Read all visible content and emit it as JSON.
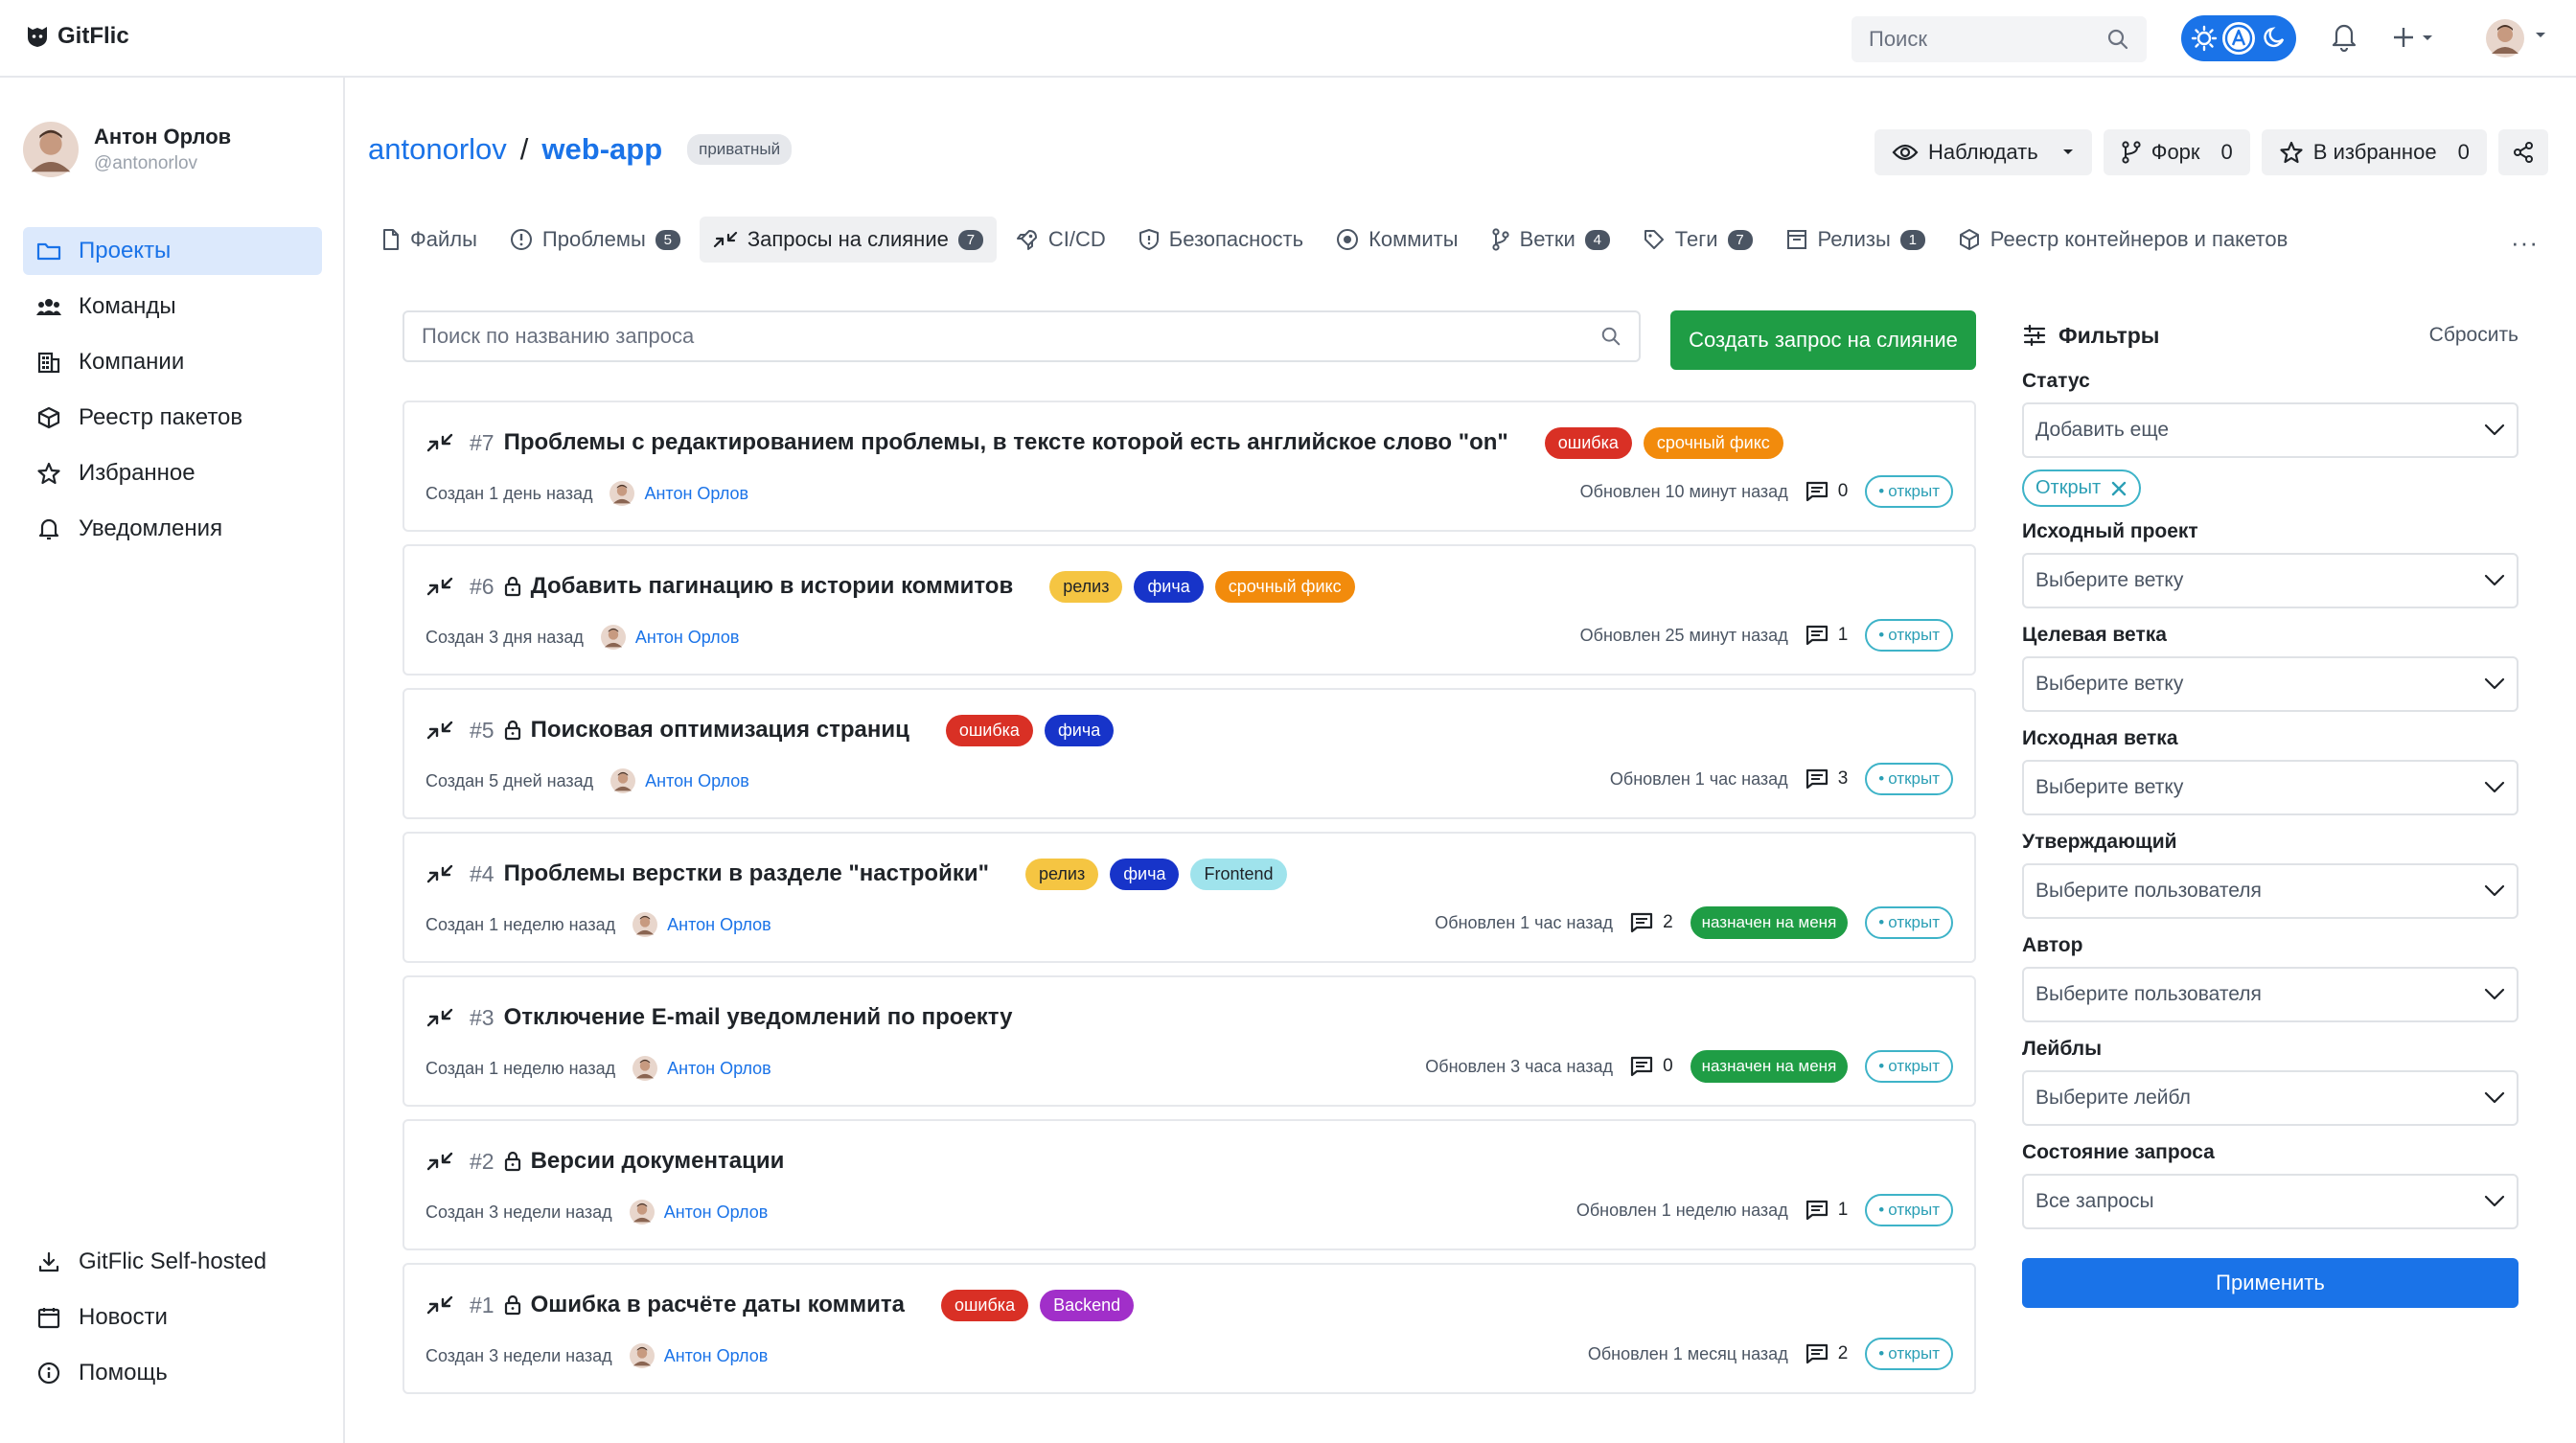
{
  "app": {
    "logo_text": "GitFlic"
  },
  "topbar": {
    "search_placeholder": "Поиск",
    "theme_options": [
      "sun-icon",
      "auto-a-icon",
      "moon-icon"
    ]
  },
  "sidebar": {
    "user": {
      "name": "Антон Орлов",
      "handle": "@antonorlov"
    },
    "items": [
      {
        "label": "Проекты",
        "icon": "folder-icon",
        "active": true
      },
      {
        "label": "Команды",
        "icon": "team-icon",
        "active": false
      },
      {
        "label": "Компании",
        "icon": "company-icon",
        "active": false
      },
      {
        "label": "Реестр пакетов",
        "icon": "package-icon",
        "active": false
      },
      {
        "label": "Избранное",
        "icon": "star-icon",
        "active": false
      },
      {
        "label": "Уведомления",
        "icon": "bell-icon",
        "active": false
      }
    ],
    "bottom_items": [
      {
        "label": "GitFlic Self-hosted",
        "icon": "download-icon"
      },
      {
        "label": "Новости",
        "icon": "calendar-icon"
      },
      {
        "label": "Помощь",
        "icon": "info-icon"
      }
    ]
  },
  "repo": {
    "owner": "antonorlov",
    "separator": "/",
    "name": "web-app",
    "visibility": "приватный",
    "watch_label": "Наблюдать",
    "fork_label": "Форк",
    "fork_count": "0",
    "fav_label": "В избранное",
    "fav_count": "0"
  },
  "tabs": [
    {
      "label": "Файлы",
      "count": null,
      "active": false,
      "icon": "file-icon"
    },
    {
      "label": "Проблемы",
      "count": "5",
      "active": false,
      "icon": "issue-icon"
    },
    {
      "label": "Запросы на слияние",
      "count": "7",
      "active": true,
      "icon": "merge-icon"
    },
    {
      "label": "CI/CD",
      "count": null,
      "active": false,
      "icon": "rocket-icon"
    },
    {
      "label": "Безопасность",
      "count": null,
      "active": false,
      "icon": "shield-icon"
    },
    {
      "label": "Коммиты",
      "count": null,
      "active": false,
      "icon": "commit-icon"
    },
    {
      "label": "Ветки",
      "count": "4",
      "active": false,
      "icon": "branch-icon"
    },
    {
      "label": "Теги",
      "count": "7",
      "active": false,
      "icon": "tag-icon"
    },
    {
      "label": "Релизы",
      "count": "1",
      "active": false,
      "icon": "release-icon"
    },
    {
      "label": "Реестр контейнеров и пакетов",
      "count": null,
      "active": false,
      "icon": "package-icon"
    }
  ],
  "tabs_more": "···",
  "mr": {
    "search_placeholder": "Поиск по названию запроса",
    "create_label": "Создать запрос на слияние",
    "items": [
      {
        "num": "#7",
        "locked": false,
        "title": "Проблемы с редактированием проблемы, в тексте которой есть английское слово \"on\"",
        "labels": [
          {
            "text": "ошибка",
            "color": "#d93025"
          },
          {
            "text": "срочный фикс",
            "color": "#f28b0c"
          }
        ],
        "created": "Создан 1 день назад",
        "author": "Антон Орлов",
        "updated": "Обновлен 10 минут назад",
        "comments": "0",
        "assigned": null,
        "status": "открыт"
      },
      {
        "num": "#6",
        "locked": true,
        "title": "Добавить пагинацию в истории коммитов",
        "labels": [
          {
            "text": "релиз",
            "color": "#f5c542",
            "dark": true
          },
          {
            "text": "фича",
            "color": "#1734c9"
          },
          {
            "text": "срочный фикс",
            "color": "#f28b0c"
          }
        ],
        "created": "Создан 3 дня назад",
        "author": "Антон Орлов",
        "updated": "Обновлен 25 минут назад",
        "comments": "1",
        "assigned": null,
        "status": "открыт"
      },
      {
        "num": "#5",
        "locked": true,
        "title": "Поисковая оптимизация страниц",
        "labels": [
          {
            "text": "ошибка",
            "color": "#d93025"
          },
          {
            "text": "фича",
            "color": "#1734c9"
          }
        ],
        "created": "Создан 5 дней назад",
        "author": "Антон Орлов",
        "updated": "Обновлен 1 час назад",
        "comments": "3",
        "assigned": null,
        "status": "открыт"
      },
      {
        "num": "#4",
        "locked": false,
        "title": "Проблемы верстки в разделе \"настройки\"",
        "labels": [
          {
            "text": "релиз",
            "color": "#f5c542",
            "dark": true
          },
          {
            "text": "фича",
            "color": "#1734c9"
          },
          {
            "text": "Frontend",
            "color": "#9fe3ec",
            "dark": true
          }
        ],
        "created": "Создан 1 неделю назад",
        "author": "Антон Орлов",
        "updated": "Обновлен 1 час назад",
        "comments": "2",
        "assigned": "назначен на меня",
        "status": "открыт"
      },
      {
        "num": "#3",
        "locked": false,
        "title": "Отключение E-mail уведомлений по проекту",
        "labels": [],
        "created": "Создан 1 неделю назад",
        "author": "Антон Орлов",
        "updated": "Обновлен 3 часа назад",
        "comments": "0",
        "assigned": "назначен на меня",
        "status": "открыт"
      },
      {
        "num": "#2",
        "locked": true,
        "title": "Версии документации",
        "labels": [],
        "created": "Создан 3 недели назад",
        "author": "Антон Орлов",
        "updated": "Обновлен 1 неделю назад",
        "comments": "1",
        "assigned": null,
        "status": "открыт"
      },
      {
        "num": "#1",
        "locked": true,
        "title": "Ошибка в расчёте даты коммита",
        "labels": [
          {
            "text": "ошибка",
            "color": "#d93025"
          },
          {
            "text": "Backend",
            "color": "#a12fc9"
          }
        ],
        "created": "Создан 3 недели назад",
        "author": "Антон Орлов",
        "updated": "Обновлен 1 месяц назад",
        "comments": "2",
        "assigned": null,
        "status": "открыт"
      }
    ]
  },
  "filters": {
    "title": "Фильтры",
    "reset": "Сбросить",
    "status_label": "Статус",
    "status_placeholder": "Добавить еще",
    "status_chip": "Открыт",
    "groups": [
      {
        "label": "Исходный проект",
        "placeholder": "Выберите ветку"
      },
      {
        "label": "Целевая ветка",
        "placeholder": "Выберите ветку"
      },
      {
        "label": "Исходная ветка",
        "placeholder": "Выберите ветку"
      },
      {
        "label": "Утверждающий",
        "placeholder": "Выберите пользователя"
      },
      {
        "label": "Автор",
        "placeholder": "Выберите пользователя"
      },
      {
        "label": "Лейблы",
        "placeholder": "Выберите лейбл"
      },
      {
        "label": "Состояние запроса",
        "placeholder": "Все запросы"
      }
    ],
    "apply": "Применить"
  }
}
